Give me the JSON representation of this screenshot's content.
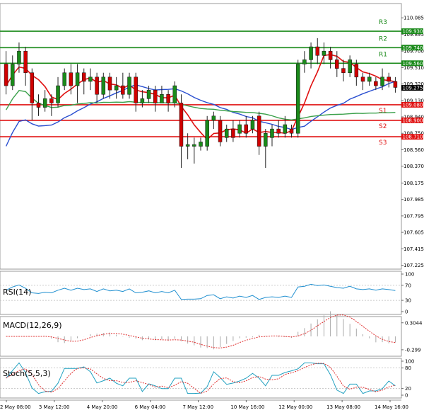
{
  "chart_data": {
    "type": "candlestick",
    "price_axis": {
      "ticks": [
        "110.085",
        "109.895",
        "109.700",
        "109.510",
        "109.320",
        "109.130",
        "108.940",
        "108.750",
        "108.560",
        "108.370",
        "108.175",
        "107.985",
        "107.795",
        "107.605",
        "107.415",
        "107.225"
      ],
      "ylim": [
        107.18,
        110.25
      ],
      "current": "109.275"
    },
    "time_labels": [
      "2 May 08:00",
      "3 May 12:00",
      "4 May 20:00",
      "6 May 04:00",
      "7 May 12:00",
      "10 May 16:00",
      "12 May 00:00",
      "13 May 08:00",
      "14 May 16:00"
    ],
    "levels": [
      {
        "name": "R3",
        "value": "109.930",
        "color": "#1a8a1a"
      },
      {
        "name": "R2",
        "value": "109.740",
        "color": "#1a8a1a"
      },
      {
        "name": "R1",
        "value": "109.560",
        "color": "#1a8a1a"
      },
      {
        "name": "S1",
        "value": "109.080",
        "color": "#e01010"
      },
      {
        "name": "S2",
        "value": "108.900",
        "color": "#e01010"
      },
      {
        "name": "S3",
        "value": "108.710",
        "color": "#e01010"
      }
    ],
    "candles": [
      [
        109.55,
        109.3,
        109.7,
        109.2
      ],
      [
        109.3,
        109.55,
        109.65,
        109.25
      ],
      [
        109.55,
        109.7,
        109.8,
        109.45
      ],
      [
        109.7,
        109.45,
        109.75,
        109.3
      ],
      [
        109.45,
        109.1,
        109.5,
        108.9
      ],
      [
        109.1,
        109.05,
        109.2,
        108.95
      ],
      [
        109.05,
        109.15,
        109.25,
        109.0
      ],
      [
        109.15,
        109.1,
        109.2,
        108.95
      ],
      [
        109.1,
        109.3,
        109.4,
        109.05
      ],
      [
        109.3,
        109.45,
        109.5,
        109.25
      ],
      [
        109.45,
        109.3,
        109.55,
        109.2
      ],
      [
        109.3,
        109.45,
        109.55,
        109.1
      ],
      [
        109.45,
        109.35,
        109.5,
        109.2
      ],
      [
        109.35,
        109.4,
        109.5,
        109.25
      ],
      [
        109.4,
        109.2,
        109.45,
        109.1
      ],
      [
        109.2,
        109.4,
        109.45,
        109.15
      ],
      [
        109.4,
        109.25,
        109.45,
        109.15
      ],
      [
        109.25,
        109.3,
        109.4,
        109.15
      ],
      [
        109.3,
        109.2,
        109.45,
        109.15
      ],
      [
        109.2,
        109.4,
        109.45,
        109.15
      ],
      [
        109.4,
        109.1,
        109.45,
        109.0
      ],
      [
        109.1,
        109.15,
        109.25,
        109.05
      ],
      [
        109.15,
        109.25,
        109.3,
        109.1
      ],
      [
        109.25,
        109.1,
        109.3,
        109.0
      ],
      [
        109.1,
        109.2,
        109.3,
        109.1
      ],
      [
        109.2,
        109.1,
        109.25,
        109.0
      ],
      [
        109.1,
        109.3,
        109.35,
        109.05
      ],
      [
        109.1,
        108.6,
        109.2,
        108.35
      ],
      [
        108.6,
        108.62,
        108.75,
        108.45
      ],
      [
        108.6,
        108.62,
        108.7,
        108.4
      ],
      [
        108.6,
        108.65,
        108.7,
        108.55
      ],
      [
        108.6,
        108.9,
        108.95,
        108.55
      ],
      [
        108.9,
        108.95,
        109.0,
        108.8
      ],
      [
        108.9,
        108.65,
        108.95,
        108.6
      ],
      [
        108.7,
        108.8,
        108.85,
        108.65
      ],
      [
        108.8,
        108.7,
        108.9,
        108.65
      ],
      [
        108.75,
        108.85,
        108.9,
        108.7
      ],
      [
        108.85,
        108.75,
        108.95,
        108.7
      ],
      [
        108.8,
        108.9,
        108.95,
        108.75
      ],
      [
        108.95,
        108.6,
        109.0,
        108.5
      ],
      [
        108.6,
        108.75,
        108.8,
        108.35
      ],
      [
        108.7,
        108.8,
        108.85,
        108.6
      ],
      [
        108.8,
        108.75,
        108.9,
        108.7
      ],
      [
        108.75,
        108.85,
        108.95,
        108.7
      ],
      [
        108.8,
        108.75,
        108.85,
        108.7
      ],
      [
        108.75,
        109.55,
        109.6,
        108.7
      ],
      [
        109.55,
        109.6,
        109.7,
        109.45
      ],
      [
        109.6,
        109.75,
        109.8,
        109.5
      ],
      [
        109.75,
        109.65,
        109.85,
        109.55
      ],
      [
        109.65,
        109.7,
        109.8,
        109.55
      ],
      [
        109.7,
        109.6,
        109.75,
        109.5
      ],
      [
        109.6,
        109.5,
        109.7,
        109.4
      ],
      [
        109.5,
        109.45,
        109.6,
        109.35
      ],
      [
        109.45,
        109.6,
        109.65,
        109.4
      ],
      [
        109.55,
        109.4,
        109.6,
        109.3
      ],
      [
        109.4,
        109.35,
        109.45,
        109.25
      ],
      [
        109.35,
        109.4,
        109.45,
        109.3
      ],
      [
        109.35,
        109.3,
        109.4,
        109.25
      ],
      [
        109.3,
        109.4,
        109.5,
        109.25
      ],
      [
        109.4,
        109.35,
        109.45,
        109.28
      ],
      [
        109.35,
        109.28,
        109.4,
        109.22
      ]
    ],
    "indicators": [
      {
        "name": "RSI(14)",
        "ticks": [
          "100",
          "70",
          "30",
          "0"
        ],
        "range": [
          0,
          100
        ]
      },
      {
        "name": "MACD(12,26,9)",
        "ticks": [
          "0.3044",
          "-0.299"
        ],
        "range": [
          -0.38,
          0.38
        ]
      },
      {
        "name": "Stoch(5,5,3)",
        "ticks": [
          "100",
          "80",
          "20",
          "0"
        ],
        "range": [
          0,
          100
        ]
      }
    ],
    "colors": {
      "up": "#1a8a1a",
      "down": "#d00000",
      "ma_fast": "#e01010",
      "ma_slow": "#2a4fd0",
      "ma_long": "#3aa04a",
      "rsi": "#1f8fd0",
      "macd": "#e03030",
      "stoch_main": "#20a0c0",
      "stoch_signal": "#e03030"
    }
  }
}
